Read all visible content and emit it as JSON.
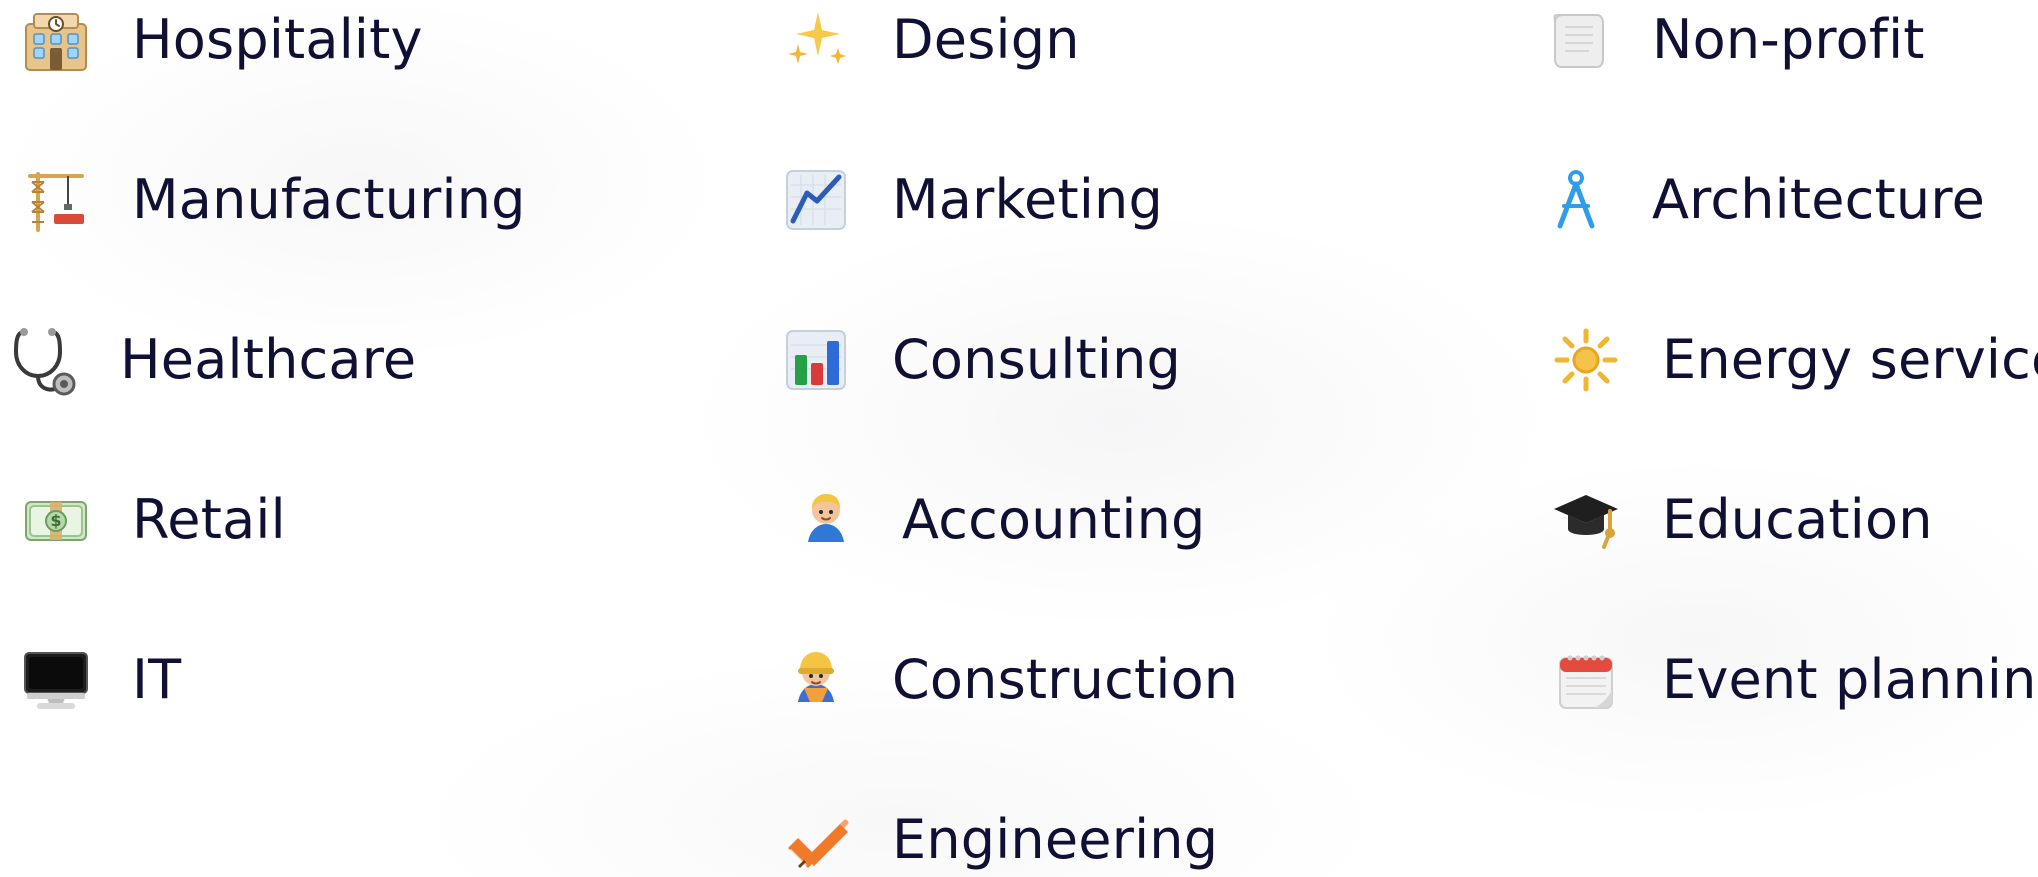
{
  "industries": {
    "col1": [
      {
        "label": "Hospitality",
        "icon": "hotel-icon"
      },
      {
        "label": "Manufacturing",
        "icon": "construction-crane-icon"
      },
      {
        "label": "Healthcare",
        "icon": "stethoscope-icon"
      },
      {
        "label": "Retail",
        "icon": "money-bill-icon"
      },
      {
        "label": "IT",
        "icon": "desktop-monitor-icon"
      }
    ],
    "col2": [
      {
        "label": "Design",
        "icon": "sparkles-icon"
      },
      {
        "label": "Marketing",
        "icon": "line-chart-icon"
      },
      {
        "label": "Consulting",
        "icon": "bar-chart-icon"
      },
      {
        "label": "Accounting",
        "icon": "man-office-worker-icon"
      },
      {
        "label": "Construction",
        "icon": "construction-worker-icon"
      },
      {
        "label": "Engineering",
        "icon": "ruler-pencil-icon"
      }
    ],
    "col3": [
      {
        "label": "Non-profit",
        "icon": "scroll-icon"
      },
      {
        "label": "Architecture",
        "icon": "drafting-compass-icon"
      },
      {
        "label": "Energy service",
        "icon": "sun-icon"
      },
      {
        "label": "Education",
        "icon": "graduation-cap-icon"
      },
      {
        "label": "Event planning",
        "icon": "calendar-icon"
      }
    ]
  },
  "colors": {
    "text": "#0f1033",
    "accent_blue": "#2f9de8",
    "accent_orange": "#f07a2a"
  }
}
